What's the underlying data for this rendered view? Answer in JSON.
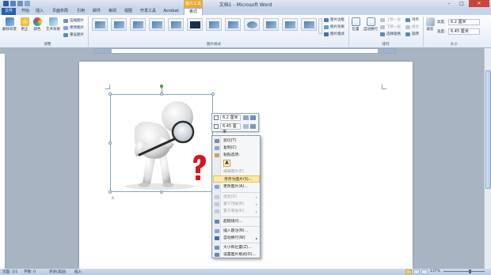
{
  "window": {
    "title": "文档1 - Microsoft Word",
    "context_tab": "图片工具",
    "minimize": "–",
    "maximize": "□",
    "close": "✕"
  },
  "tabs": [
    "文件",
    "开始",
    "插入",
    "页面布局",
    "引用",
    "邮件",
    "审阅",
    "视图",
    "开发工具",
    "Acrobat",
    "格式"
  ],
  "ribbon": {
    "remove_bg": "删除背景",
    "corrections": "更正",
    "color": "颜色",
    "artistic": "艺术效果",
    "compress": "压缩图片",
    "change": "更改图片",
    "reset": "重设图片",
    "group_adjust": "调整",
    "group_styles": "图片样式",
    "border": "图片边框",
    "effects": "图片效果",
    "layout": "图片版式",
    "position": "位置",
    "wrap": "自动换行",
    "bring_forward": "上移一层",
    "send_backward": "下移一层",
    "selection_pane": "选择窗格",
    "align": "对齐",
    "group": "组合",
    "rotate": "旋转",
    "group_arrange": "排列",
    "crop": "裁剪",
    "height_label": "高度:",
    "height_value": "6.2 厘米",
    "width_label": "宽度:",
    "width_value": "6.45 厘米",
    "group_size": "大小"
  },
  "minibar": {
    "height": "6.2 厘米",
    "width": "6.45 厘米"
  },
  "context_menu": {
    "cut": "剪切(T)",
    "copy": "复制(C)",
    "paste_options": "粘贴选项:",
    "paste_glyph": "A",
    "edit_picture": "编辑图片(E)",
    "save_as_picture": "另存为图片(S)...",
    "change_picture": "更改图片(A)...",
    "group": "组合(G)",
    "bring_to_front": "置于顶层(R)",
    "send_to_back": "置于底层(K)",
    "hyperlink": "超链接(I)...",
    "insert_caption": "插入题注(N)...",
    "wrap_text": "自动换行(W)",
    "size_position": "大小和位置(Z)...",
    "format_picture": "设置图片格式(O)..."
  },
  "status": {
    "page": "页面: 1/1",
    "words": "字数: 0",
    "language": "英语(美国)",
    "mode": "插入",
    "zoom": "137%"
  },
  "colors": {
    "accent": "#2a5fa8",
    "context_tab": "#e6a93a",
    "menu_highlight": "#fbe9a6",
    "question_mark": "#d8141e"
  }
}
